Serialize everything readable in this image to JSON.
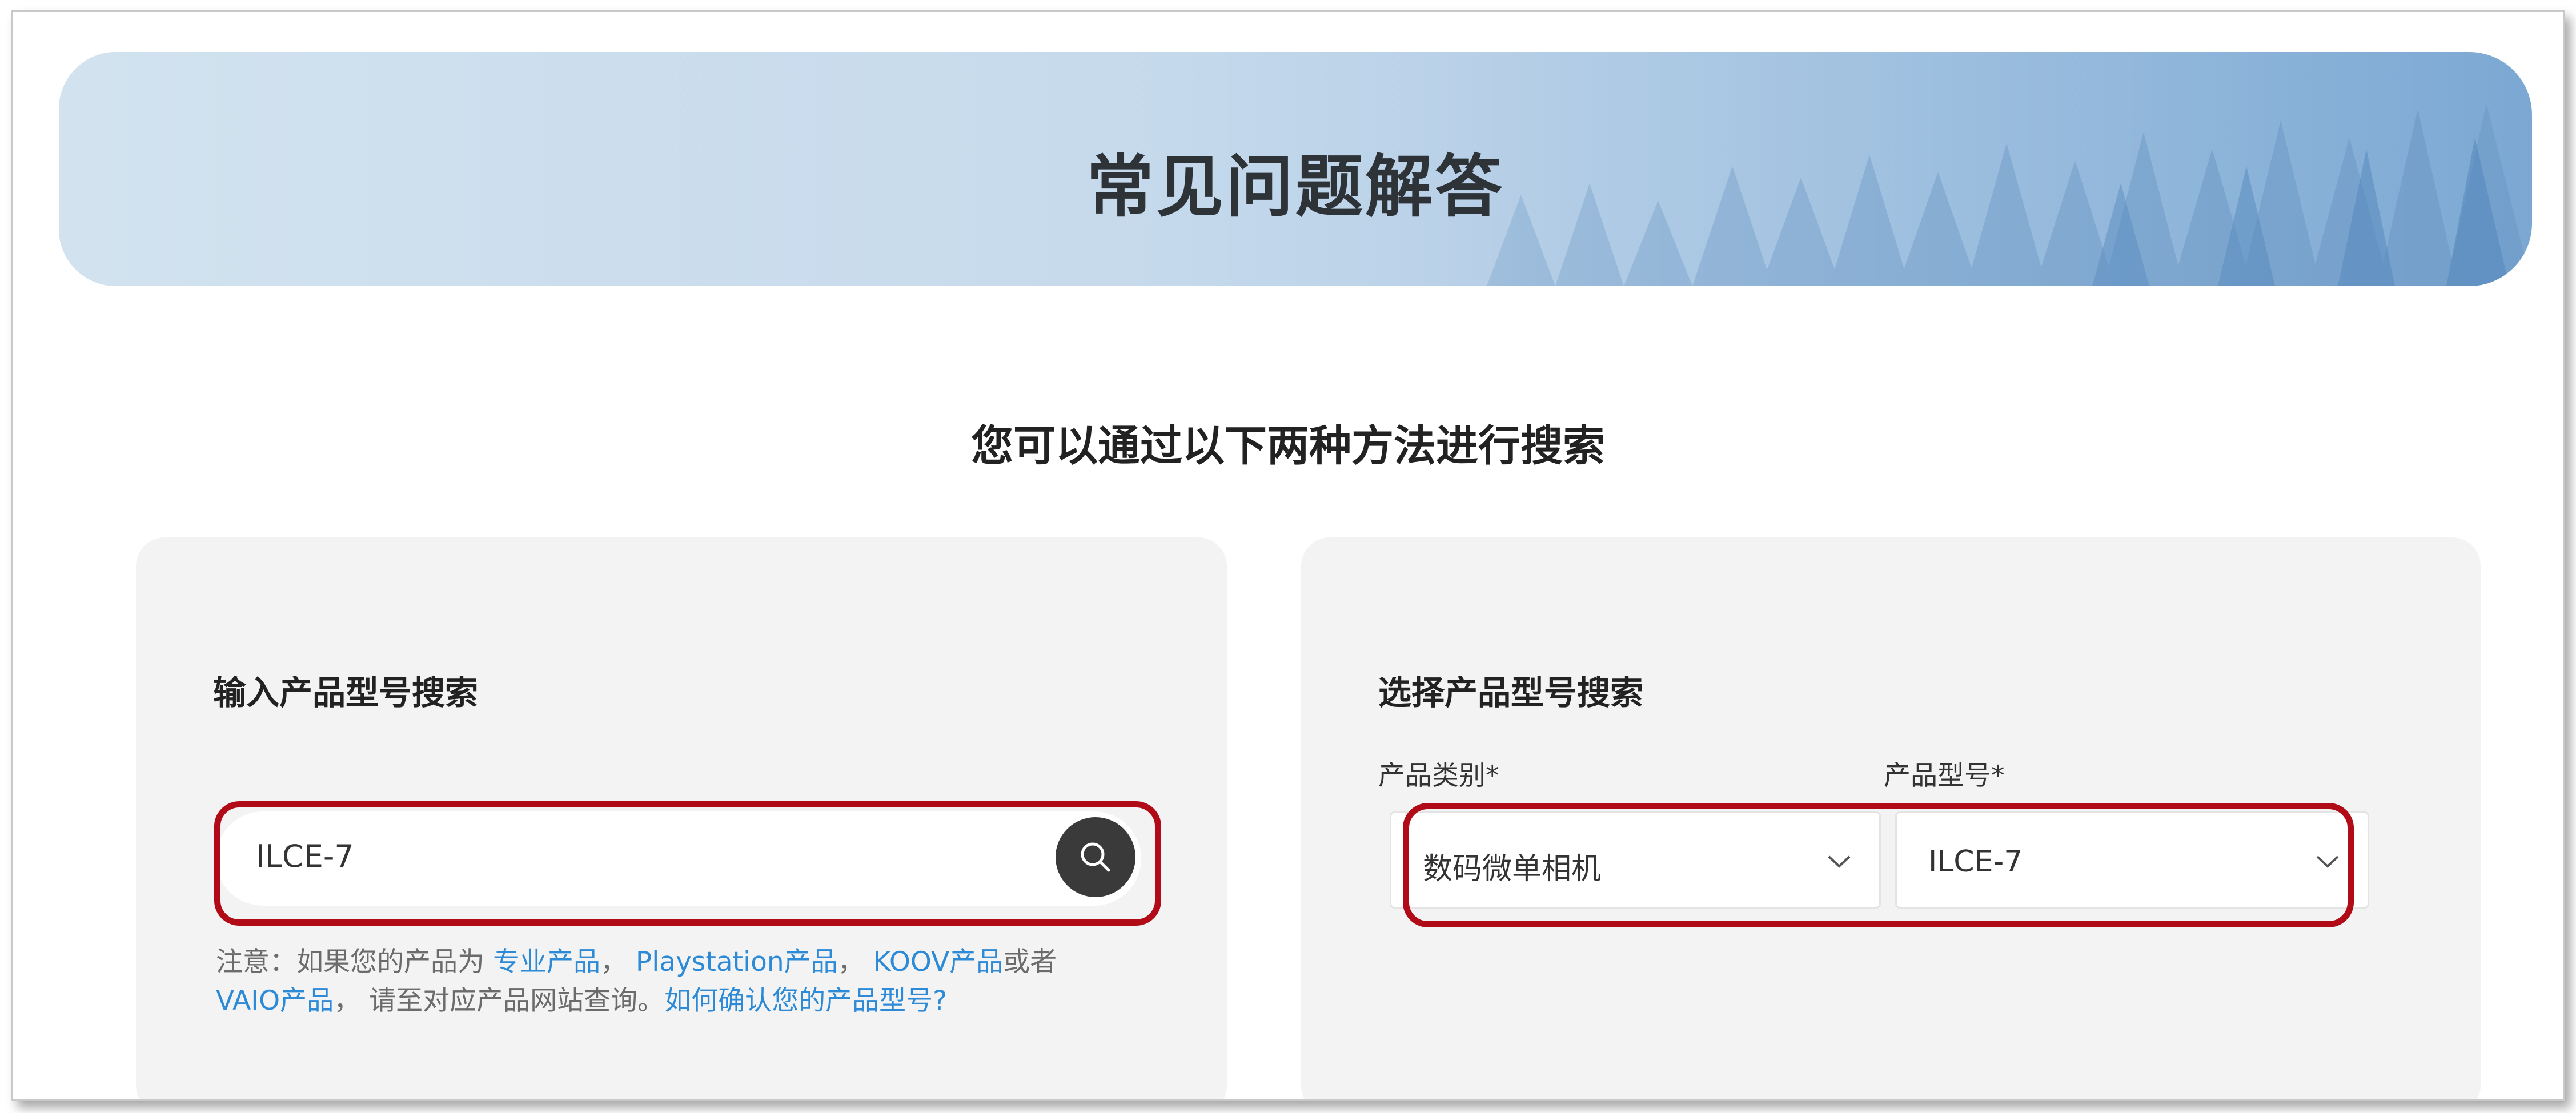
{
  "banner": {
    "title": "常见问题解答"
  },
  "subtitle": "您可以通过以下两种方法进行搜索",
  "left_card": {
    "title": "输入产品型号搜索",
    "search": {
      "value": "ILCE-7"
    },
    "note": {
      "prefix": "注意：如果您的产品为 ",
      "link1": "专业产品",
      "sep1": "， ",
      "link2": "Playstation产品",
      "sep2": "， ",
      "link3": "KOOV产品",
      "mid": "或者",
      "link4": "VAIO产品",
      "suffix": "， 请至对应产品网站查询。",
      "help_link": "如何确认您的产品型号?"
    }
  },
  "right_card": {
    "title": "选择产品型号搜索",
    "category": {
      "label": "产品类别*",
      "value": "数码微单相机"
    },
    "model": {
      "label": "产品型号*",
      "value": "ILCE-7"
    }
  },
  "colors": {
    "highlight": "#b00b16",
    "link": "#2c8ad6",
    "card_bg": "#f3f3f3"
  }
}
